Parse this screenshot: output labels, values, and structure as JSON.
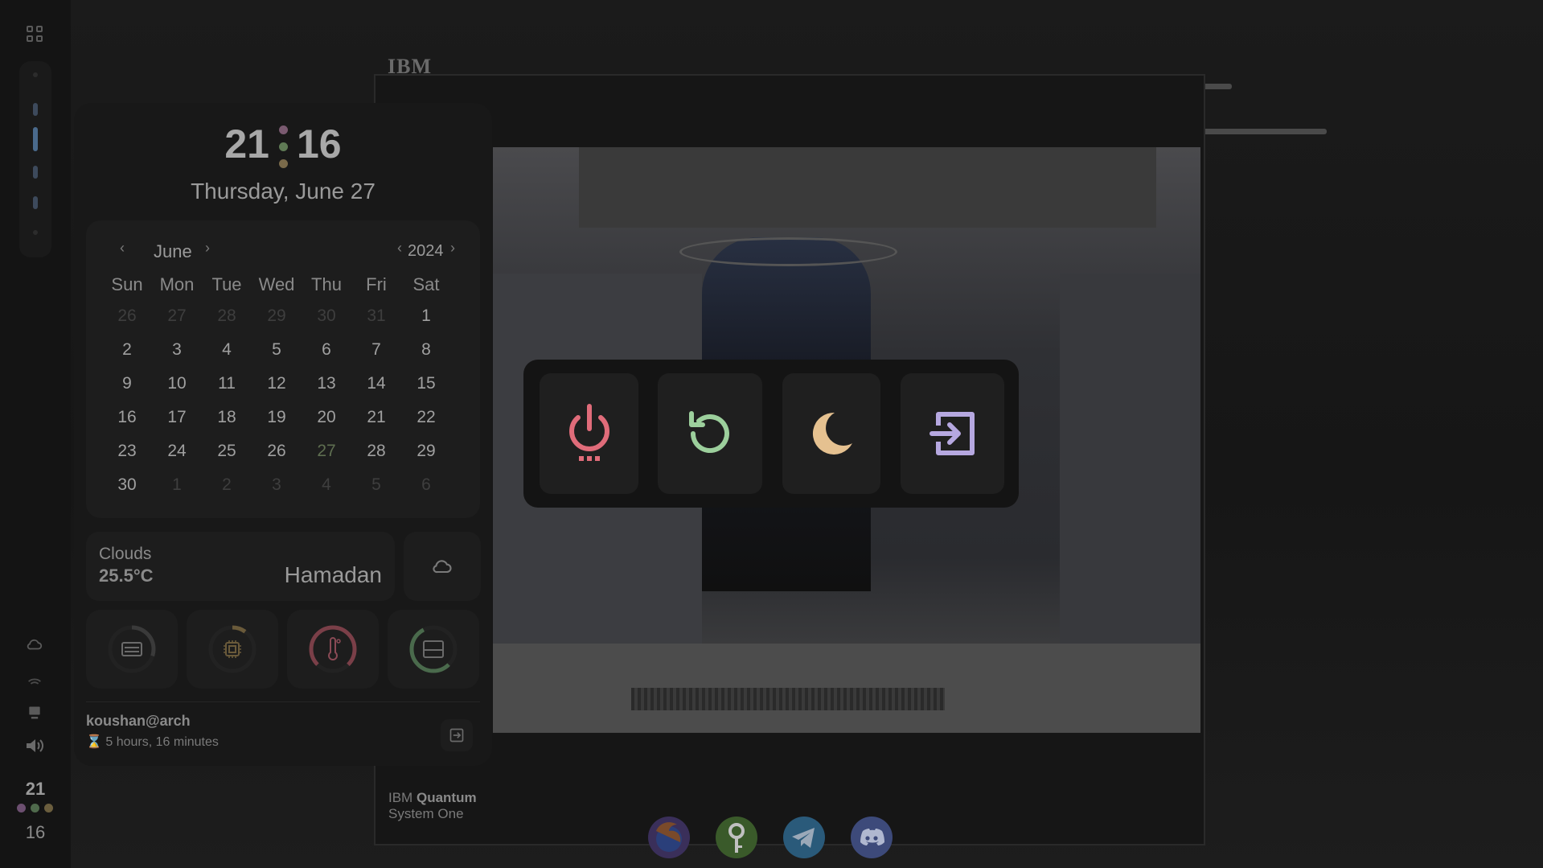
{
  "wallpaper": {
    "brand": "IBM",
    "caption_line1_prefix": "IBM",
    "caption_line1_bold": "Quantum",
    "caption_line2": "System One"
  },
  "clock": {
    "hours": "21",
    "minutes": "16",
    "date": "Thursday, June 27"
  },
  "calendar": {
    "prev_month": "‹",
    "month": "June",
    "next_month": "›",
    "prev_year": "‹",
    "year": "2024",
    "next_year": "›",
    "weekdays": [
      "Sun",
      "Mon",
      "Tue",
      "Wed",
      "Thu",
      "Fri",
      "Sat"
    ],
    "days": [
      [
        "26",
        "27",
        "28",
        "29",
        "30",
        "31",
        "1"
      ],
      [
        "2",
        "3",
        "4",
        "5",
        "6",
        "7",
        "8"
      ],
      [
        "9",
        "10",
        "11",
        "12",
        "13",
        "14",
        "15"
      ],
      [
        "16",
        "17",
        "18",
        "19",
        "20",
        "21",
        "22"
      ],
      [
        "23",
        "24",
        "25",
        "26",
        "27",
        "28",
        "29"
      ],
      [
        "30",
        "1",
        "2",
        "3",
        "4",
        "5",
        "6"
      ]
    ],
    "today": "27"
  },
  "weather": {
    "condition": "Clouds",
    "temperature": "25.5°C",
    "city": "Hamadan",
    "icon": "cloud-icon"
  },
  "gauges": [
    {
      "icon": "memory-icon",
      "level": 0.3
    },
    {
      "icon": "cpu-icon",
      "level": 0.1
    },
    {
      "icon": "thermometer-icon",
      "level": 0.75
    },
    {
      "icon": "disk-icon",
      "level": 0.55
    }
  ],
  "session": {
    "user": "koushan@arch",
    "uptime": "⌛ 5 hours, 16 minutes"
  },
  "power_menu": [
    {
      "name": "shutdown",
      "icon": "power-icon",
      "color": "#e06c7a"
    },
    {
      "name": "reboot",
      "icon": "restart-icon",
      "color": "#9ccf9c"
    },
    {
      "name": "suspend",
      "icon": "moon-icon",
      "color": "#e5c190"
    },
    {
      "name": "logout",
      "icon": "logout-icon",
      "color": "#b6a8e0"
    }
  ],
  "leftbar": {
    "clock_hours": "21",
    "clock_minutes": "16",
    "dot_colors": [
      "#6c4f70",
      "#4f6a4c",
      "#6b5e3e"
    ]
  },
  "dock": [
    "firefox-icon",
    "keepassxc-icon",
    "telegram-icon",
    "discord-icon"
  ],
  "colors": {
    "accent_red": "#e06c7a",
    "accent_green": "#9ccf9c",
    "accent_yellow": "#e5c190",
    "accent_purple": "#b6a8e0"
  }
}
